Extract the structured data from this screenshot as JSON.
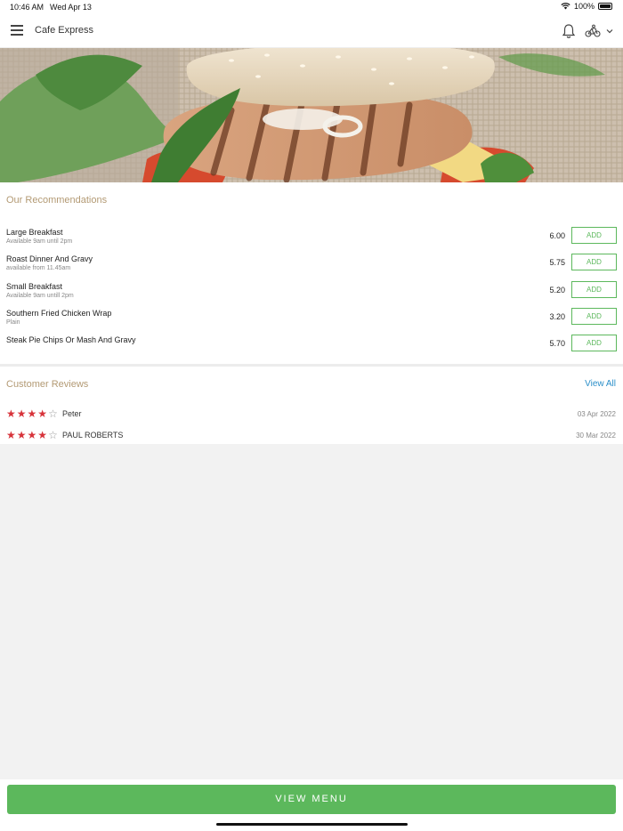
{
  "status_bar": {
    "time": "10:46 AM",
    "date": "Wed Apr 13",
    "battery": "100%"
  },
  "header": {
    "title": "Cafe Express",
    "icons": [
      "menu-icon",
      "bell-icon",
      "bike-icon",
      "chevron-down-icon"
    ]
  },
  "hero": {
    "image": "burger-photo"
  },
  "recommendations": {
    "title": "Our Recommendations",
    "add_label": "ADD",
    "items": [
      {
        "name": "Large Breakfast",
        "subtitle": "Available 9am until 2pm",
        "price": "6.00"
      },
      {
        "name": "Roast Dinner And Gravy",
        "subtitle": "available from 11.45am",
        "price": "5.75"
      },
      {
        "name": "Small Breakfast",
        "subtitle": "Available 9am untill 2pm",
        "price": "5.20"
      },
      {
        "name": "Southern Fried Chicken Wrap",
        "subtitle": "Plain",
        "price": "3.20"
      },
      {
        "name": "Steak Pie Chips Or Mash And Gravy",
        "subtitle": "",
        "price": "5.70"
      }
    ]
  },
  "reviews": {
    "title": "Customer Reviews",
    "view_all": "View All",
    "items": [
      {
        "name": "Peter",
        "date": "03 Apr 2022",
        "rating": 4,
        "max_rating": 5
      },
      {
        "name": "PAUL ROBERTS",
        "date": "30 Mar 2022",
        "rating": 4,
        "max_rating": 5
      }
    ]
  },
  "footer": {
    "view_menu": "VIEW MENU"
  },
  "colors": {
    "accent_green": "#5cb85c",
    "section_title": "#b39a74",
    "link_blue": "#2b8fc9",
    "star_red": "#d7333a"
  }
}
